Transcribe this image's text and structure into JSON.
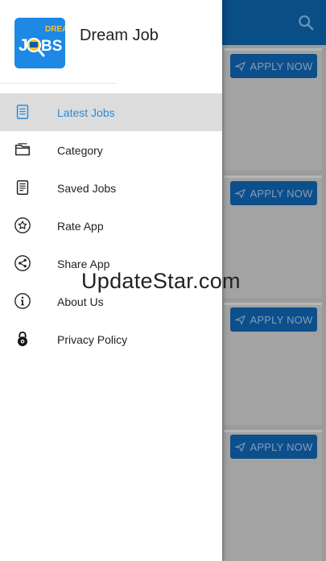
{
  "app": {
    "title": "Dream Job"
  },
  "logo": {
    "top_text": "DREAM",
    "main_text_left": "J",
    "main_text_right": "BS"
  },
  "menu": {
    "items": [
      {
        "label": "Latest Jobs",
        "icon": "document-icon",
        "active": true
      },
      {
        "label": "Category",
        "icon": "folder-icon",
        "active": false
      },
      {
        "label": "Saved Jobs",
        "icon": "document-list-icon",
        "active": false
      },
      {
        "label": "Rate App",
        "icon": "star-icon",
        "active": false
      },
      {
        "label": "Share App",
        "icon": "share-icon",
        "active": false
      },
      {
        "label": "About Us",
        "icon": "info-icon",
        "active": false
      },
      {
        "label": "Privacy Policy",
        "icon": "lock-icon",
        "active": false
      }
    ]
  },
  "background": {
    "apply_buttons": [
      "APPLY NOW",
      "APPLY NOW",
      "APPLY NOW",
      "APPLY NOW"
    ]
  },
  "watermark": "UpdateStar.com",
  "colors": {
    "accent": "#2b8ad6",
    "toolbar": "#0a4e86",
    "active_bg": "#dcdcdc"
  }
}
